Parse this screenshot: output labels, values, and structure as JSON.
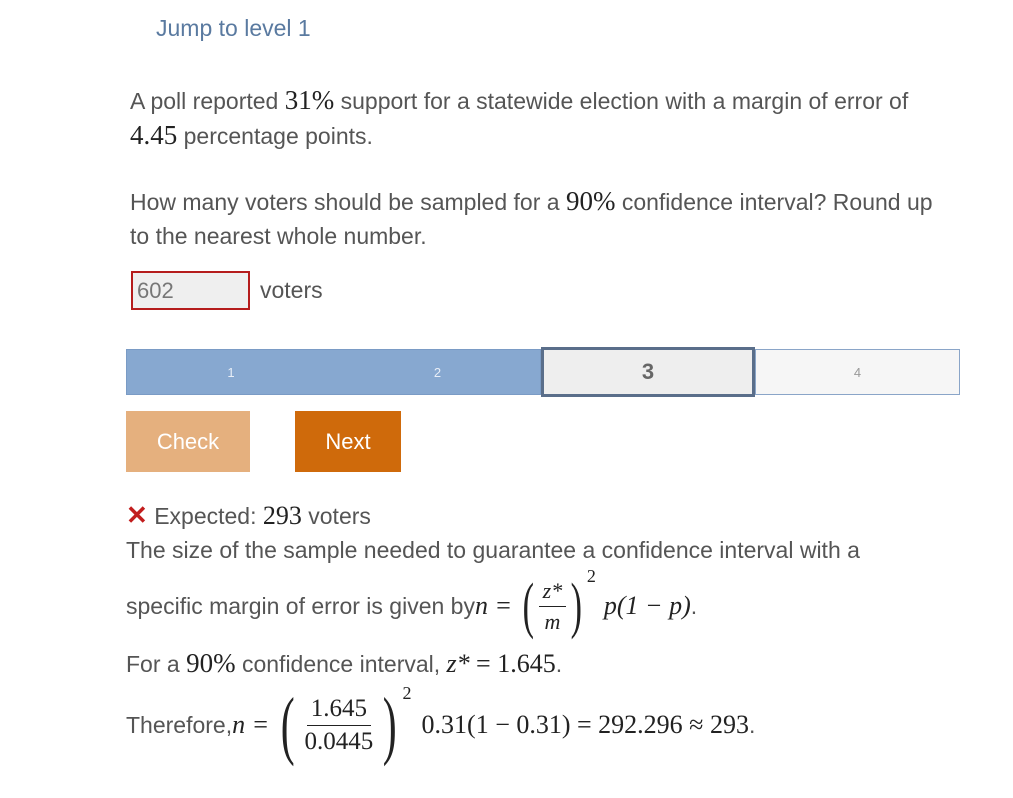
{
  "header": {
    "jump_link": "Jump to level 1"
  },
  "question": {
    "p1_a": "A poll reported ",
    "p1_pct": "31%",
    "p1_b": " support for a statewide election with a margin of error of",
    "p1_moe": "4.45",
    "p1_c": " percentage points.",
    "p2_a": "How many voters should be sampled for a ",
    "p2_pct": "90%",
    "p2_b": " confidence interval? Round up",
    "p2_c": "to the nearest whole number."
  },
  "answer": {
    "value": "602",
    "unit": "voters",
    "status": "incorrect"
  },
  "progress": {
    "levels": [
      "1",
      "2",
      "3",
      "4"
    ],
    "current": "3"
  },
  "buttons": {
    "check": "Check",
    "next": "Next"
  },
  "feedback": {
    "expected_label": "Expected: ",
    "expected_value": "293",
    "expected_unit": " voters",
    "line1": "The size of the sample needed to guarantee a confidence interval with a",
    "line2_a": "specific margin of error is given by ",
    "line3_a": "For a ",
    "line3_pct": "90%",
    "line3_b": " confidence interval, ",
    "line3_eq": "= 1.645",
    "line3_end": ".",
    "line4_a": "Therefore, ",
    "frac_num": "1.645",
    "frac_den": "0.0445",
    "exp": "2",
    "line4_tail": "0.31(1 − 0.31) = 292.296 ≈ 293",
    "line4_end": "."
  },
  "colors": {
    "accent_link": "#5a7aa0",
    "error_red": "#b51c1c",
    "progress_done": "#87a8d0",
    "progress_current_border": "#5a6e8a",
    "check_btn": "#e5b07e",
    "next_btn": "#cf6a0b"
  },
  "icons": {
    "incorrect": "x-mark-icon"
  }
}
